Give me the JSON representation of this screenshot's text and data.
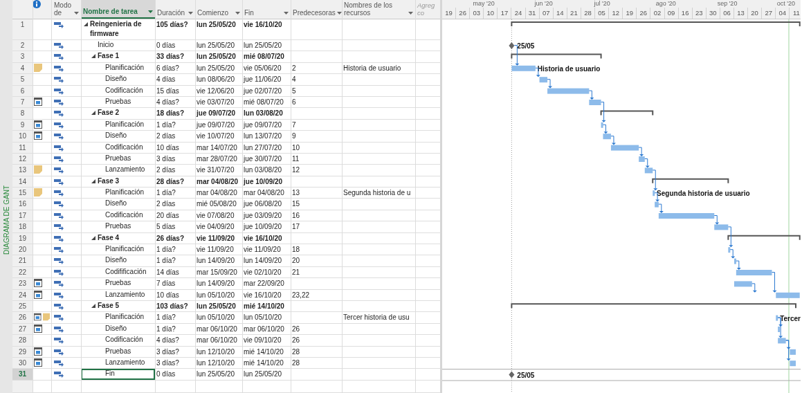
{
  "view_label": "DIAGRAMA DE GANT",
  "table": {
    "columns": [
      {
        "label": "Modo de",
        "selected": false
      },
      {
        "label": "Nombre de tarea",
        "selected": true
      },
      {
        "label": "Duración",
        "selected": false
      },
      {
        "label": "Comienzo",
        "selected": false
      },
      {
        "label": "Fin",
        "selected": false
      },
      {
        "label": "Predecesoras",
        "selected": false
      },
      {
        "label": "Nombres de los recursos",
        "selected": false
      },
      {
        "label": "Agreg co",
        "selected": false
      }
    ]
  },
  "timescale": {
    "months": [
      "may '20",
      "jun '20",
      "jul '20",
      "ago '20",
      "sep '20",
      "oct '20"
    ],
    "weeks": [
      "19",
      "26",
      "03",
      "10",
      "17",
      "24",
      "31",
      "07",
      "14",
      "21",
      "28",
      "05",
      "12",
      "19",
      "26",
      "02",
      "09",
      "16",
      "23",
      "30",
      "06",
      "13",
      "20",
      "27",
      "04",
      "11"
    ]
  },
  "tasks": [
    {
      "id": "1",
      "name": "Reingenieria de firmware",
      "kind": "summary",
      "expanded": true,
      "selected": false,
      "duration": "105 días?",
      "start": "lun 25/05/20",
      "end": "vie 16/10/20",
      "children": [
        {
          "id": "2",
          "name": "Inicio",
          "kind": "milestone",
          "selected": false,
          "duration": "0 días",
          "start": "lun 25/05/20",
          "end": "lun 25/05/20",
          "bar_label": "25/05"
        },
        {
          "id": "3",
          "name": "Fase 1",
          "kind": "summary",
          "expanded": true,
          "selected": false,
          "duration": "33 días?",
          "start": "lun 25/05/20",
          "end": "mié 08/07/20",
          "children": [
            {
              "id": "4",
              "name": "Planificación",
              "kind": "task",
              "selected": false,
              "indicators": [
                {
                  "kind": "note"
                }
              ],
              "duration": "6 días?",
              "start": "lun 25/05/20",
              "end": "vie 05/06/20",
              "predecessors": "2",
              "resources": "Historia de usuario",
              "bar_label": "Historia de usuario"
            },
            {
              "id": "5",
              "name": "Diseño",
              "kind": "task",
              "selected": false,
              "duration": "4 días",
              "start": "lun 08/06/20",
              "end": "jue 11/06/20",
              "predecessors": "4"
            },
            {
              "id": "6",
              "name": "Codificación",
              "kind": "task",
              "selected": false,
              "duration": "15 días",
              "start": "vie 12/06/20",
              "end": "jue 02/07/20",
              "predecessors": "5"
            },
            {
              "id": "7",
              "name": "Pruebas",
              "kind": "task",
              "selected": false,
              "indicators": [
                {
                  "kind": "calendar"
                }
              ],
              "duration": "4 días?",
              "start": "vie 03/07/20",
              "end": "mié 08/07/20",
              "predecessors": "6"
            }
          ]
        },
        {
          "id": "8",
          "name": "Fase 2",
          "kind": "summary",
          "expanded": true,
          "selected": false,
          "duration": "18 días?",
          "start": "jue 09/07/20",
          "end": "lun 03/08/20",
          "children": [
            {
              "id": "9",
              "name": "Planificación",
              "kind": "task",
              "selected": false,
              "indicators": [
                {
                  "kind": "calendar"
                }
              ],
              "duration": "1 día?",
              "start": "jue 09/07/20",
              "end": "jue 09/07/20",
              "predecessors": "7"
            },
            {
              "id": "10",
              "name": "Diseño",
              "kind": "task",
              "selected": false,
              "indicators": [
                {
                  "kind": "calendar"
                }
              ],
              "duration": "2 días",
              "start": "vie 10/07/20",
              "end": "lun 13/07/20",
              "predecessors": "9"
            },
            {
              "id": "11",
              "name": "Codificación",
              "kind": "task",
              "selected": false,
              "duration": "10 días",
              "start": "mar 14/07/20",
              "end": "lun 27/07/20",
              "predecessors": "10"
            },
            {
              "id": "12",
              "name": "Pruebas",
              "kind": "task",
              "selected": false,
              "duration": "3 días",
              "start": "mar 28/07/20",
              "end": "jue 30/07/20",
              "predecessors": "11"
            },
            {
              "id": "13",
              "name": "Lanzamiento",
              "kind": "task",
              "selected": false,
              "indicators": [
                {
                  "kind": "note"
                }
              ],
              "duration": "2 días",
              "start": "vie 31/07/20",
              "end": "lun 03/08/20",
              "predecessors": "12"
            }
          ]
        },
        {
          "id": "14",
          "name": "Fase 3",
          "kind": "summary",
          "expanded": true,
          "selected": false,
          "duration": "28 días?",
          "start": "mar 04/08/20",
          "end": "jue 10/09/20",
          "children": [
            {
              "id": "15",
              "name": "Planificación",
              "kind": "task",
              "selected": false,
              "indicators": [
                {
                  "kind": "note"
                }
              ],
              "duration": "1 día?",
              "start": "mar 04/08/20",
              "end": "mar 04/08/20",
              "predecessors": "13",
              "resources": "Segunda historia de u",
              "bar_label": "Segunda historia de usuario"
            },
            {
              "id": "16",
              "name": "Diseño",
              "kind": "task",
              "selected": false,
              "duration": "2 días",
              "start": "mié 05/08/20",
              "end": "jue 06/08/20",
              "predecessors": "15"
            },
            {
              "id": "17",
              "name": "Codificación",
              "kind": "task",
              "selected": false,
              "duration": "20 días",
              "start": "vie 07/08/20",
              "end": "jue 03/09/20",
              "predecessors": "16"
            },
            {
              "id": "18",
              "name": "Pruebas",
              "kind": "task",
              "selected": false,
              "duration": "5 días",
              "start": "vie 04/09/20",
              "end": "jue 10/09/20",
              "predecessors": "17"
            }
          ]
        },
        {
          "id": "19",
          "name": "Fase 4",
          "kind": "summary",
          "expanded": true,
          "selected": false,
          "duration": "26 días?",
          "start": "vie 11/09/20",
          "end": "vie 16/10/20",
          "children": [
            {
              "id": "20",
              "name": "Planificación",
              "kind": "task",
              "selected": false,
              "duration": "1 día?",
              "start": "vie 11/09/20",
              "end": "vie 11/09/20",
              "predecessors": "18"
            },
            {
              "id": "21",
              "name": "Diseño",
              "kind": "task",
              "selected": false,
              "duration": "1 día?",
              "start": "lun 14/09/20",
              "end": "lun 14/09/20",
              "predecessors": "20"
            },
            {
              "id": "22",
              "name": "Codifificación",
              "kind": "task",
              "selected": false,
              "duration": "14 días",
              "start": "mar 15/09/20",
              "end": "vie 02/10/20",
              "predecessors": "21"
            },
            {
              "id": "23",
              "name": "Pruebas",
              "kind": "task",
              "selected": false,
              "indicators": [
                {
                  "kind": "calendar"
                }
              ],
              "duration": "7 días",
              "start": "lun 14/09/20",
              "end": "mar 22/09/20"
            },
            {
              "id": "24",
              "name": "Lanzamiento",
              "kind": "task",
              "selected": false,
              "indicators": [
                {
                  "kind": "calendar"
                }
              ],
              "duration": "10 días",
              "start": "lun 05/10/20",
              "end": "vie 16/10/20",
              "predecessors": "23,22"
            }
          ]
        },
        {
          "id": "25",
          "name": "Fase 5",
          "kind": "summary",
          "expanded": true,
          "selected": false,
          "duration": "103 días?",
          "start": "lun 25/05/20",
          "end": "mié 14/10/20",
          "children": [
            {
              "id": "26",
              "name": "Planificación",
              "kind": "task",
              "selected": false,
              "indicators": [
                {
                  "kind": "calendar"
                },
                {
                  "kind": "note"
                }
              ],
              "duration": "1 día?",
              "start": "lun 05/10/20",
              "end": "lun 05/10/20",
              "resources": "Tercer historia de usu",
              "bar_label": "Tercer"
            },
            {
              "id": "27",
              "name": "Diseño",
              "kind": "task",
              "selected": false,
              "indicators": [
                {
                  "kind": "calendar"
                }
              ],
              "duration": "1 día?",
              "start": "mar 06/10/20",
              "end": "mar 06/10/20",
              "predecessors": "26"
            },
            {
              "id": "28",
              "name": "Codificación",
              "kind": "task",
              "selected": false,
              "duration": "4 días?",
              "start": "mar 06/10/20",
              "end": "vie 09/10/20",
              "predecessors": "26"
            },
            {
              "id": "29",
              "name": "Pruebas",
              "kind": "task",
              "selected": false,
              "indicators": [
                {
                  "kind": "calendar"
                }
              ],
              "duration": "3 días?",
              "start": "lun 12/10/20",
              "end": "mié 14/10/20",
              "predecessors": "28"
            },
            {
              "id": "30",
              "name": "Lanzamiento",
              "kind": "task",
              "selected": false,
              "indicators": [
                {
                  "kind": "calendar"
                }
              ],
              "duration": "3 días?",
              "start": "lun 12/10/20",
              "end": "mié 14/10/20",
              "predecessors": "28"
            },
            {
              "id": "31",
              "name": "Fin",
              "kind": "milestone",
              "selected": true,
              "duration": "0 días",
              "start": "lun 25/05/20",
              "end": "lun 25/05/20",
              "bar_label": "25/05"
            }
          ]
        }
      ]
    }
  ]
}
